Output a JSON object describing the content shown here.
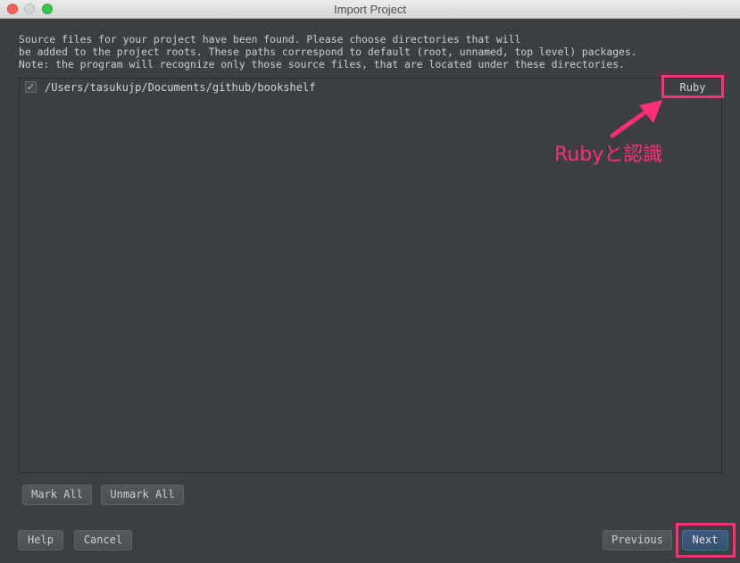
{
  "window": {
    "title": "Import Project"
  },
  "description": {
    "line1": "Source files for your project have been found. Please choose directories that will",
    "line2": "be added to the project roots. These paths correspond to default (root, unnamed, top level) packages.",
    "line3": "Note: the program will recognize only those source files, that are located under these directories."
  },
  "roots": [
    {
      "checked": true,
      "path": "/Users/tasukujp/Documents/github/bookshelf",
      "language": "Ruby"
    }
  ],
  "buttons": {
    "mark_all": "Mark All",
    "unmark_all": "Unmark All",
    "help": "Help",
    "cancel": "Cancel",
    "previous": "Previous",
    "next": "Next"
  },
  "annotation": {
    "text": "Rubyと認識",
    "color": "#ff2d7a"
  },
  "icons": {
    "checkbox": "checkmark-icon",
    "arrow": "arrow-up-right-icon"
  }
}
